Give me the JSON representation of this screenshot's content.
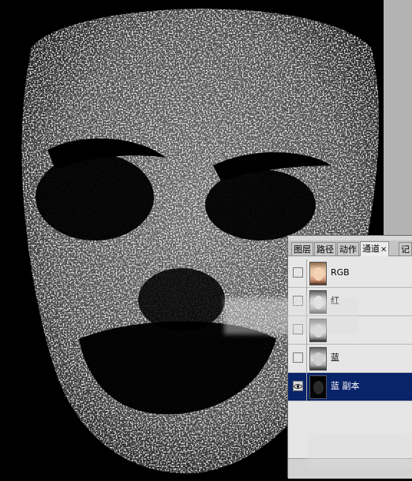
{
  "panel": {
    "tabs": [
      {
        "label": "图层",
        "active": false
      },
      {
        "label": "路径",
        "active": false
      },
      {
        "label": "动作",
        "active": false
      },
      {
        "label": "通道",
        "active": true,
        "close": "×"
      },
      {
        "label": "记",
        "active": false
      }
    ],
    "channels": [
      {
        "name": "RGB",
        "visible": false,
        "thumb": "color",
        "selected": false
      },
      {
        "name": "红",
        "visible": false,
        "thumb": "gray",
        "selected": false
      },
      {
        "name": "",
        "visible": false,
        "thumb": "gray",
        "selected": false
      },
      {
        "name": "蓝",
        "visible": false,
        "thumb": "gray",
        "selected": false
      },
      {
        "name": "蓝 副本",
        "visible": true,
        "thumb": "dark",
        "selected": true
      }
    ]
  },
  "colors": {
    "selection": "#0a246a",
    "panel_bg": "#e6e6e6",
    "canvas": "#000000"
  },
  "icons": {
    "visibility": "eye-icon"
  }
}
